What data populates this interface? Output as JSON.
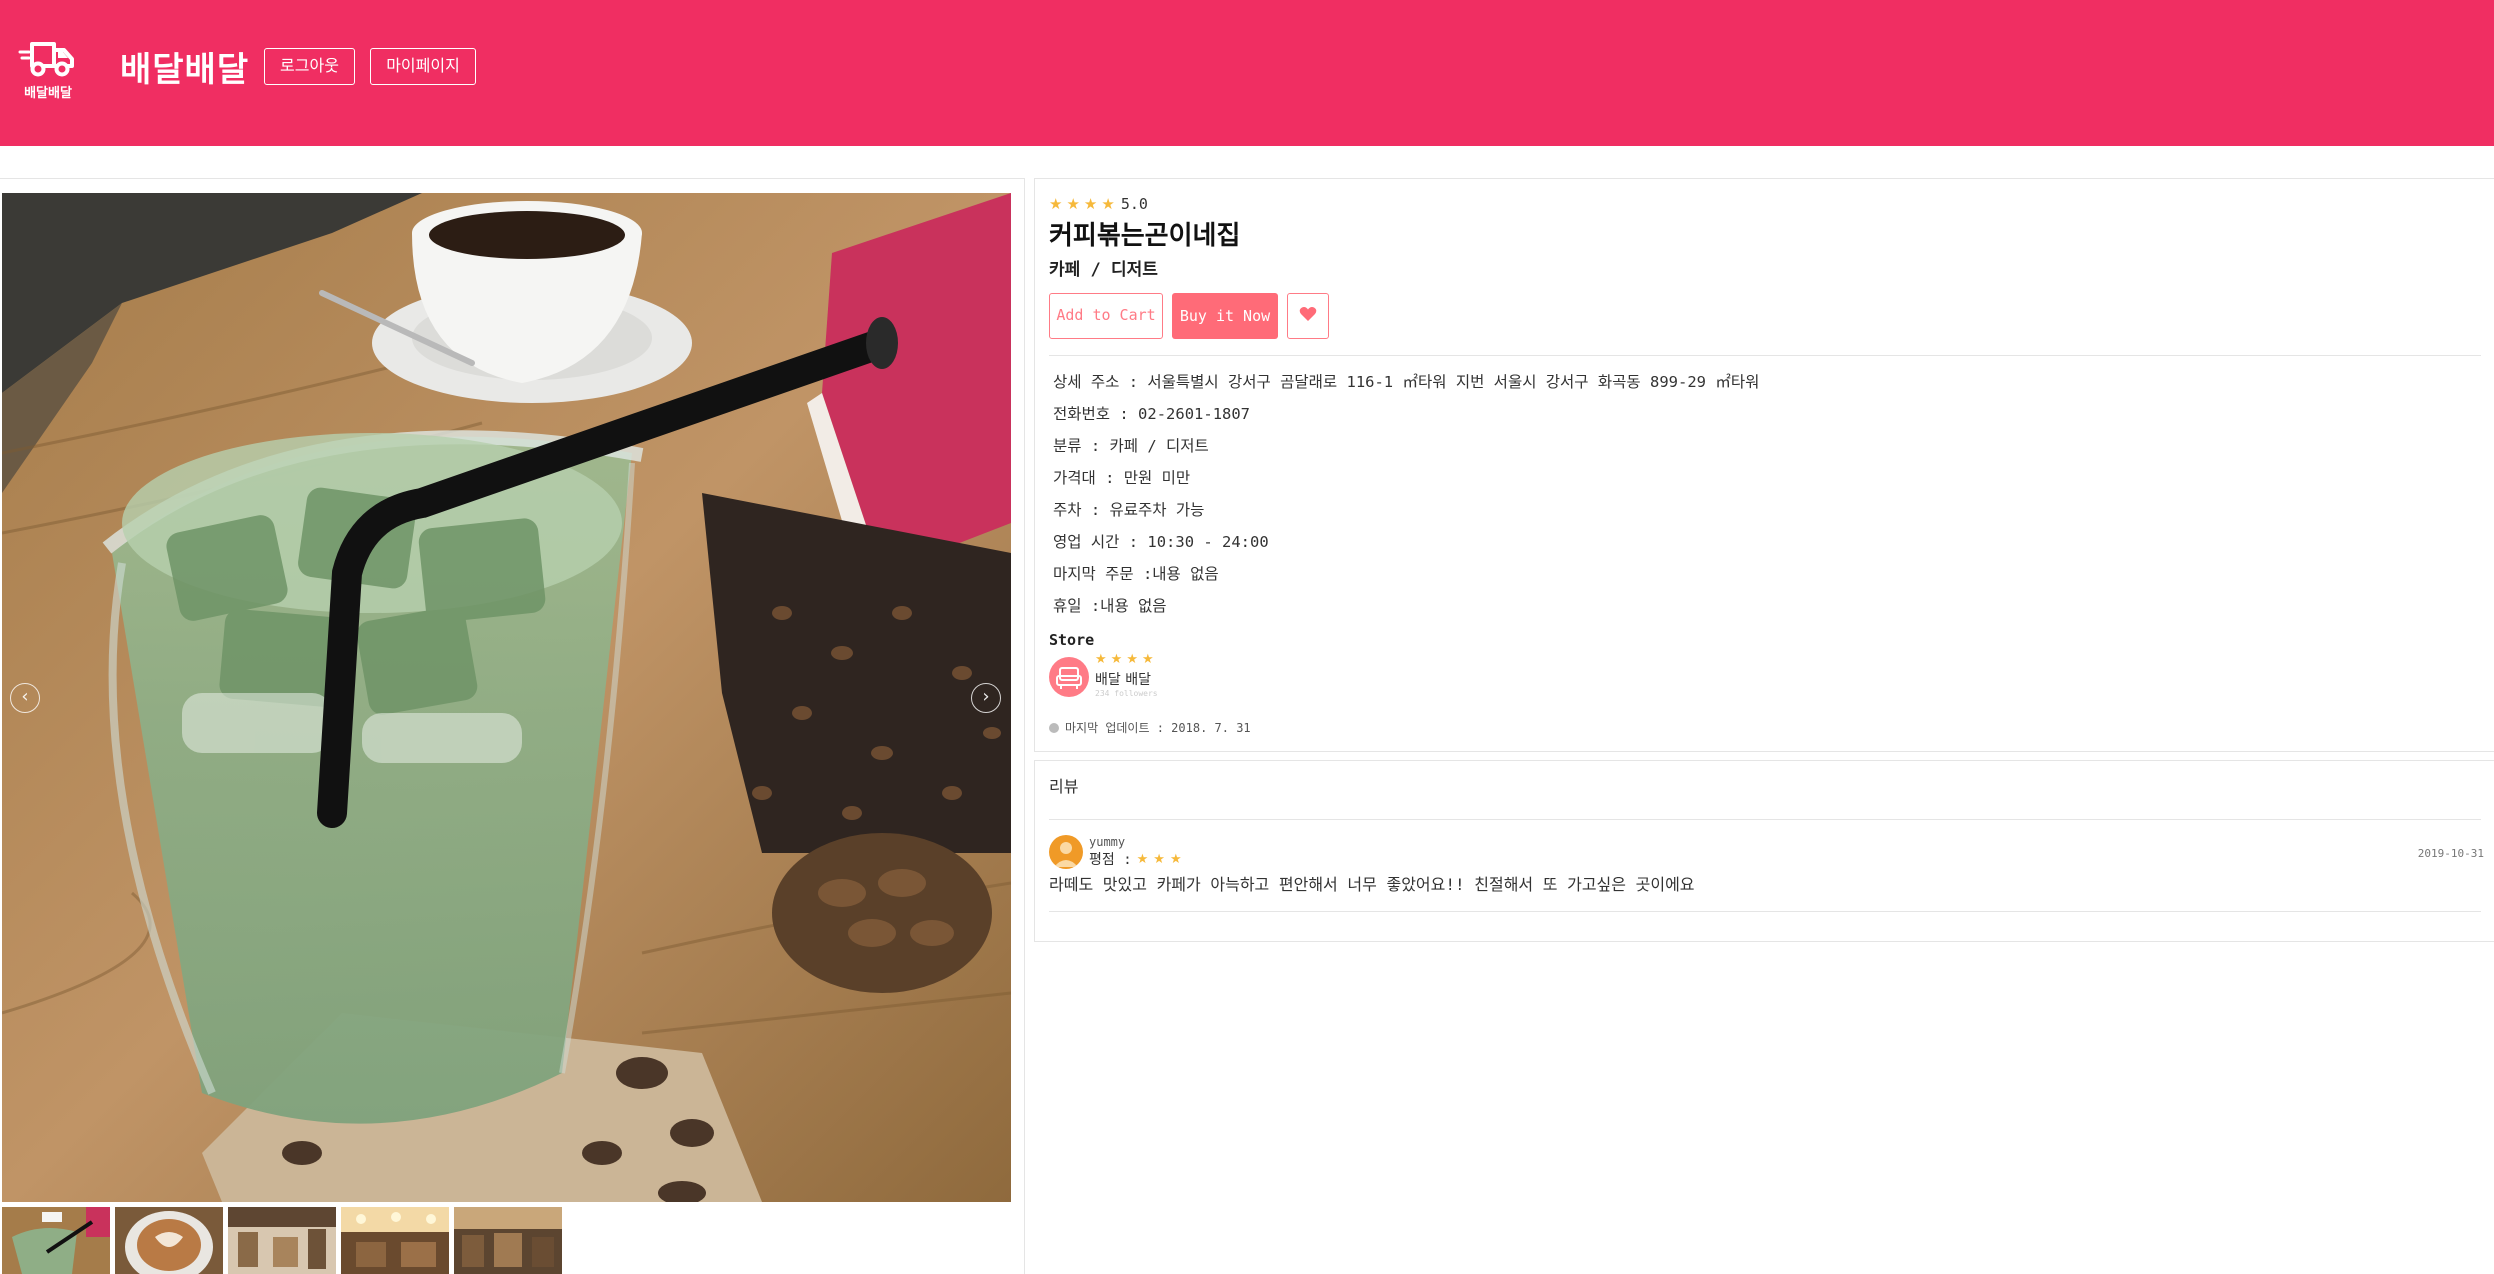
{
  "header": {
    "logo_text": "배달배달",
    "brand": "배달배달",
    "logout_label": "로그아웃",
    "mypage_label": "마이페이지",
    "color": "#f02e62"
  },
  "gallery": {
    "prev_icon": "‹",
    "next_icon": "›",
    "thumbnail_count": 5
  },
  "store": {
    "rating_stars": 4,
    "rating_value": "5.0",
    "name": "커피볶는곤이네집",
    "category": "카페 / 디저트",
    "add_to_cart_label": "Add to Cart",
    "buy_now_label": "Buy it Now",
    "info": [
      "상세 주소 : 서울특별시 강서구 곰달래로 116-1 ㎡타워 지번 서울시 강서구 화곡동 899-29 ㎡타워",
      "전화번호 : 02-2601-1807",
      "분류 : 카페 / 디저트",
      "가격대 : 만원 미만",
      "주차 : 유료주차 가능",
      "영업 시간 : 10:30 - 24:00",
      "마지막 주문 :내용 없음",
      "휴일 :내용 없음"
    ],
    "store_label": "Store",
    "seller": {
      "stars": 4,
      "name": "배달 배달",
      "followers": "234 followers"
    },
    "last_update": "마지막 업데이트 : 2018. 7. 31"
  },
  "reviews": {
    "title": "리뷰",
    "items": [
      {
        "user": "yummy",
        "score_label": "평점 :",
        "stars": 3,
        "date": "2019-10-31",
        "text": "라떼도 맛있고 카페가 아늑하고 편안해서 너무 좋았어요!! 친절해서 또 가고싶은 곳이에요"
      }
    ]
  },
  "colors": {
    "accent": "#f02e62",
    "button": "#ff6b78",
    "star": "#f6b93b"
  }
}
